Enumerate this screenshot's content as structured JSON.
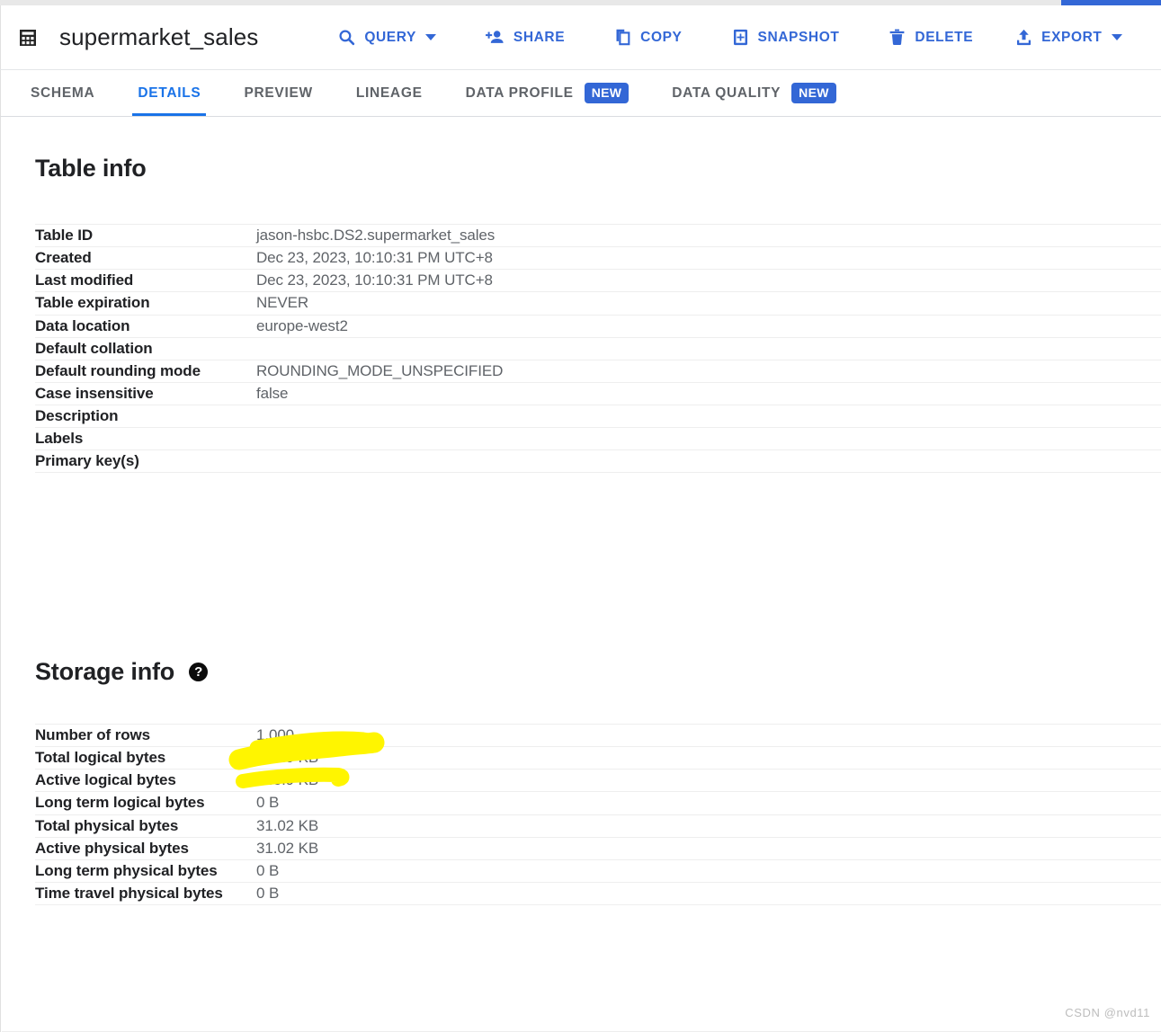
{
  "topbar": {
    "table_icon": "table-grid-icon",
    "title": "supermarket_sales",
    "actions": [
      {
        "label": "QUERY",
        "icon": "search-icon",
        "caret": true
      },
      {
        "label": "SHARE",
        "icon": "person-add-icon",
        "caret": false
      },
      {
        "label": "COPY",
        "icon": "copy-icon",
        "caret": false
      },
      {
        "label": "SNAPSHOT",
        "icon": "snapshot-icon",
        "caret": false
      },
      {
        "label": "DELETE",
        "icon": "trash-icon",
        "caret": false
      },
      {
        "label": "EXPORT",
        "icon": "export-icon",
        "caret": true
      }
    ]
  },
  "tabs": [
    {
      "label": "SCHEMA",
      "active": false,
      "badge": ""
    },
    {
      "label": "DETAILS",
      "active": true,
      "badge": ""
    },
    {
      "label": "PREVIEW",
      "active": false,
      "badge": ""
    },
    {
      "label": "LINEAGE",
      "active": false,
      "badge": ""
    },
    {
      "label": "DATA PROFILE",
      "active": false,
      "badge": "NEW"
    },
    {
      "label": "DATA QUALITY",
      "active": false,
      "badge": "NEW"
    }
  ],
  "table_info": {
    "heading": "Table info",
    "rows": [
      {
        "key": "Table ID",
        "value": "jason-hsbc.DS2.supermarket_sales"
      },
      {
        "key": "Created",
        "value": "Dec 23, 2023, 10:10:31 PM UTC+8"
      },
      {
        "key": "Last modified",
        "value": "Dec 23, 2023, 10:10:31 PM UTC+8"
      },
      {
        "key": "Table expiration",
        "value": "NEVER"
      },
      {
        "key": "Data location",
        "value": "europe-west2"
      },
      {
        "key": "Default collation",
        "value": ""
      },
      {
        "key": "Default rounding mode",
        "value": "ROUNDING_MODE_UNSPECIFIED"
      },
      {
        "key": "Case insensitive",
        "value": "false"
      },
      {
        "key": "Description",
        "value": ""
      },
      {
        "key": "Labels",
        "value": ""
      },
      {
        "key": "Primary key(s)",
        "value": ""
      }
    ]
  },
  "storage_info": {
    "heading": "Storage info",
    "help_icon": "help-circle-icon",
    "rows": [
      {
        "key": "Number of rows",
        "value": "1,000"
      },
      {
        "key": "Total logical bytes",
        "value": "145.9 KB"
      },
      {
        "key": "Active logical bytes",
        "value": "145.9 KB"
      },
      {
        "key": "Long term logical bytes",
        "value": "0 B"
      },
      {
        "key": "Total physical bytes",
        "value": "31.02 KB"
      },
      {
        "key": "Active physical bytes",
        "value": "31.02 KB"
      },
      {
        "key": "Long term physical bytes",
        "value": "0 B"
      },
      {
        "key": "Time travel physical bytes",
        "value": "0 B"
      }
    ]
  },
  "annotation": {
    "marker_color": "#FFF500",
    "target_value": "145.9 KB"
  },
  "watermark": "CSDN @nvd11",
  "colors": {
    "accent_blue": "#3367d6",
    "tab_active": "#1a73e8",
    "text_primary": "#202124",
    "text_secondary": "#5f6368",
    "divider": "#eeeeee"
  }
}
